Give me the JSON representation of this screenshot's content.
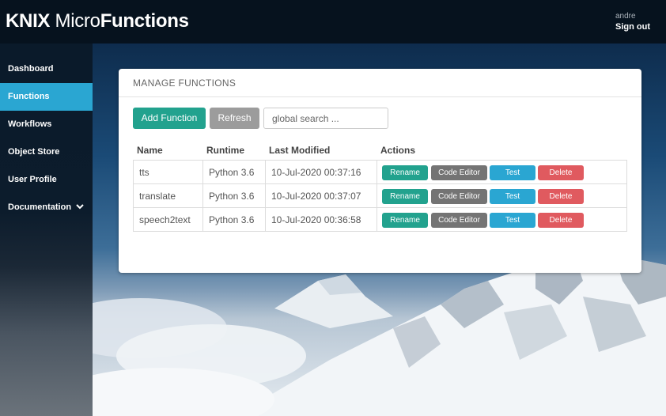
{
  "header": {
    "brand_part1": "KNIX",
    "brand_part2": " Micro",
    "brand_part3": "Functions",
    "username": "andre",
    "signout_label": "Sign out"
  },
  "sidebar": {
    "items": [
      {
        "label": "Dashboard"
      },
      {
        "label": "Functions",
        "active": true
      },
      {
        "label": "Workflows"
      },
      {
        "label": "Object Store"
      },
      {
        "label": "User Profile"
      },
      {
        "label": "Documentation",
        "expandable": true
      }
    ]
  },
  "panel": {
    "title": "MANAGE FUNCTIONS",
    "add_label": "Add Function",
    "refresh_label": "Refresh",
    "search_placeholder": "global search ...",
    "columns": [
      "Name",
      "Runtime",
      "Last Modified",
      "Actions"
    ],
    "rows": [
      {
        "name": "tts",
        "runtime": "Python 3.6",
        "modified": "10-Jul-2020 00:37:16"
      },
      {
        "name": "translate",
        "runtime": "Python 3.6",
        "modified": "10-Jul-2020 00:37:07"
      },
      {
        "name": "speech2text",
        "runtime": "Python 3.6",
        "modified": "10-Jul-2020 00:36:58"
      }
    ],
    "actions": {
      "rename": "Rename",
      "code_editor": "Code Editor",
      "test": "Test",
      "delete": "Delete"
    }
  },
  "colors": {
    "accent_teal": "#22a28e",
    "accent_blue": "#2aa6d2",
    "danger": "#e05a5f",
    "neutral": "#747474"
  },
  "icons": {
    "documentation_expand": "chevron-down-icon"
  }
}
